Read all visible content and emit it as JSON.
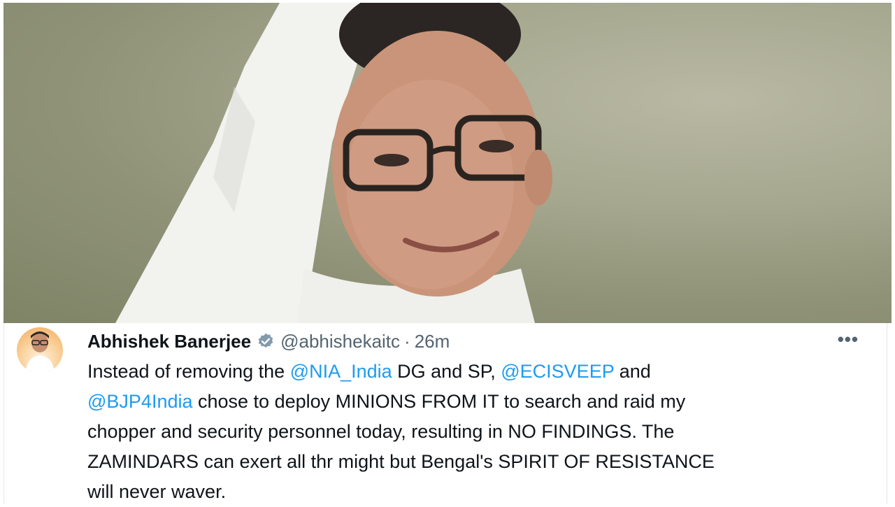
{
  "tweet": {
    "display_name": "Abhishek Banerjee",
    "handle": "@abhishekaitc",
    "separator": "·",
    "time": "26m",
    "more_label": "•••",
    "text": {
      "l1_a": "Instead of removing the ",
      "l1_m1": "@NIA_India",
      "l1_b": " DG and SP,  ",
      "l1_m2": "@ECISVEEP",
      "l1_c": " and",
      "l2_m": "@BJP4India",
      "l2_b": " chose to deploy MINIONS FROM IT to search and raid my",
      "l3": "chopper and security personnel today, resulting in NO FINDINGS. The",
      "l4": "ZAMINDARS can exert all thr might but Bengal's SPIRIT OF RESISTANCE",
      "l5": "will never waver."
    }
  },
  "icons": {
    "verified": "verified-badge-icon",
    "more": "more-icon"
  },
  "colors": {
    "mention": "#1d9bf0",
    "secondary": "#536471",
    "primary_text": "#0f1419",
    "badge": "#829aab"
  }
}
